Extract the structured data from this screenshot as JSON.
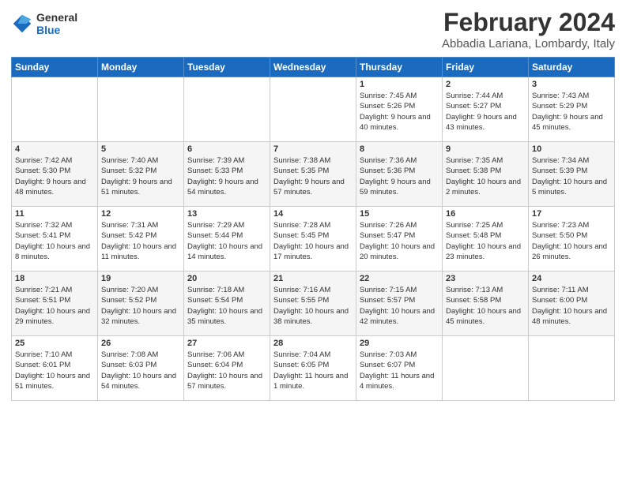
{
  "logo": {
    "text_general": "General",
    "text_blue": "Blue"
  },
  "header": {
    "month": "February 2024",
    "location": "Abbadia Lariana, Lombardy, Italy"
  },
  "weekdays": [
    "Sunday",
    "Monday",
    "Tuesday",
    "Wednesday",
    "Thursday",
    "Friday",
    "Saturday"
  ],
  "weeks": [
    [
      {
        "day": "",
        "info": ""
      },
      {
        "day": "",
        "info": ""
      },
      {
        "day": "",
        "info": ""
      },
      {
        "day": "",
        "info": ""
      },
      {
        "day": "1",
        "info": "Sunrise: 7:45 AM\nSunset: 5:26 PM\nDaylight: 9 hours\nand 40 minutes."
      },
      {
        "day": "2",
        "info": "Sunrise: 7:44 AM\nSunset: 5:27 PM\nDaylight: 9 hours\nand 43 minutes."
      },
      {
        "day": "3",
        "info": "Sunrise: 7:43 AM\nSunset: 5:29 PM\nDaylight: 9 hours\nand 45 minutes."
      }
    ],
    [
      {
        "day": "4",
        "info": "Sunrise: 7:42 AM\nSunset: 5:30 PM\nDaylight: 9 hours\nand 48 minutes."
      },
      {
        "day": "5",
        "info": "Sunrise: 7:40 AM\nSunset: 5:32 PM\nDaylight: 9 hours\nand 51 minutes."
      },
      {
        "day": "6",
        "info": "Sunrise: 7:39 AM\nSunset: 5:33 PM\nDaylight: 9 hours\nand 54 minutes."
      },
      {
        "day": "7",
        "info": "Sunrise: 7:38 AM\nSunset: 5:35 PM\nDaylight: 9 hours\nand 57 minutes."
      },
      {
        "day": "8",
        "info": "Sunrise: 7:36 AM\nSunset: 5:36 PM\nDaylight: 9 hours\nand 59 minutes."
      },
      {
        "day": "9",
        "info": "Sunrise: 7:35 AM\nSunset: 5:38 PM\nDaylight: 10 hours\nand 2 minutes."
      },
      {
        "day": "10",
        "info": "Sunrise: 7:34 AM\nSunset: 5:39 PM\nDaylight: 10 hours\nand 5 minutes."
      }
    ],
    [
      {
        "day": "11",
        "info": "Sunrise: 7:32 AM\nSunset: 5:41 PM\nDaylight: 10 hours\nand 8 minutes."
      },
      {
        "day": "12",
        "info": "Sunrise: 7:31 AM\nSunset: 5:42 PM\nDaylight: 10 hours\nand 11 minutes."
      },
      {
        "day": "13",
        "info": "Sunrise: 7:29 AM\nSunset: 5:44 PM\nDaylight: 10 hours\nand 14 minutes."
      },
      {
        "day": "14",
        "info": "Sunrise: 7:28 AM\nSunset: 5:45 PM\nDaylight: 10 hours\nand 17 minutes."
      },
      {
        "day": "15",
        "info": "Sunrise: 7:26 AM\nSunset: 5:47 PM\nDaylight: 10 hours\nand 20 minutes."
      },
      {
        "day": "16",
        "info": "Sunrise: 7:25 AM\nSunset: 5:48 PM\nDaylight: 10 hours\nand 23 minutes."
      },
      {
        "day": "17",
        "info": "Sunrise: 7:23 AM\nSunset: 5:50 PM\nDaylight: 10 hours\nand 26 minutes."
      }
    ],
    [
      {
        "day": "18",
        "info": "Sunrise: 7:21 AM\nSunset: 5:51 PM\nDaylight: 10 hours\nand 29 minutes."
      },
      {
        "day": "19",
        "info": "Sunrise: 7:20 AM\nSunset: 5:52 PM\nDaylight: 10 hours\nand 32 minutes."
      },
      {
        "day": "20",
        "info": "Sunrise: 7:18 AM\nSunset: 5:54 PM\nDaylight: 10 hours\nand 35 minutes."
      },
      {
        "day": "21",
        "info": "Sunrise: 7:16 AM\nSunset: 5:55 PM\nDaylight: 10 hours\nand 38 minutes."
      },
      {
        "day": "22",
        "info": "Sunrise: 7:15 AM\nSunset: 5:57 PM\nDaylight: 10 hours\nand 42 minutes."
      },
      {
        "day": "23",
        "info": "Sunrise: 7:13 AM\nSunset: 5:58 PM\nDaylight: 10 hours\nand 45 minutes."
      },
      {
        "day": "24",
        "info": "Sunrise: 7:11 AM\nSunset: 6:00 PM\nDaylight: 10 hours\nand 48 minutes."
      }
    ],
    [
      {
        "day": "25",
        "info": "Sunrise: 7:10 AM\nSunset: 6:01 PM\nDaylight: 10 hours\nand 51 minutes."
      },
      {
        "day": "26",
        "info": "Sunrise: 7:08 AM\nSunset: 6:03 PM\nDaylight: 10 hours\nand 54 minutes."
      },
      {
        "day": "27",
        "info": "Sunrise: 7:06 AM\nSunset: 6:04 PM\nDaylight: 10 hours\nand 57 minutes."
      },
      {
        "day": "28",
        "info": "Sunrise: 7:04 AM\nSunset: 6:05 PM\nDaylight: 11 hours\nand 1 minute."
      },
      {
        "day": "29",
        "info": "Sunrise: 7:03 AM\nSunset: 6:07 PM\nDaylight: 11 hours\nand 4 minutes."
      },
      {
        "day": "",
        "info": ""
      },
      {
        "day": "",
        "info": ""
      }
    ]
  ]
}
